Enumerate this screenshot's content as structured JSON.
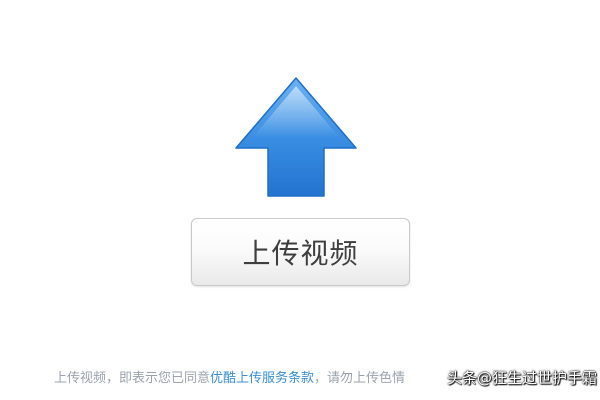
{
  "upload": {
    "arrow_icon": "upload-arrow-icon",
    "arrow_color": "#3a8ee3",
    "button_label": "上传视频"
  },
  "terms": {
    "prefix": "上传视频，即表示您已同意",
    "link_text": "优酷上传服务条款",
    "suffix": "，请勿上传色情",
    "link_color": "#3b8fd1"
  },
  "watermark": {
    "text": "头条@狂生过世护手霜"
  }
}
